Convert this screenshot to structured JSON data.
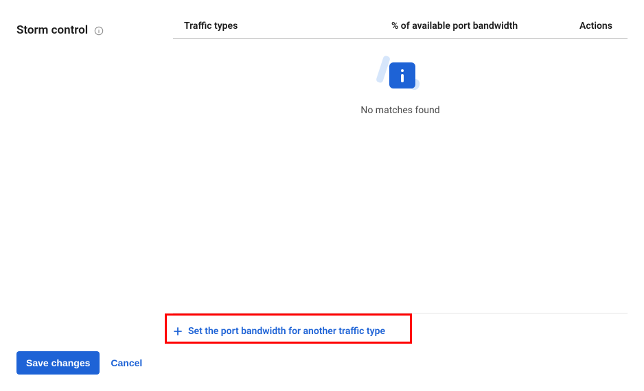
{
  "section": {
    "title": "Storm control"
  },
  "table": {
    "headers": {
      "traffic_types": "Traffic types",
      "bandwidth": "% of available port bandwidth",
      "actions": "Actions"
    },
    "empty_message": "No matches found"
  },
  "add_action": {
    "label": "Set the port bandwidth for another traffic type"
  },
  "footer": {
    "save": "Save changes",
    "cancel": "Cancel"
  }
}
